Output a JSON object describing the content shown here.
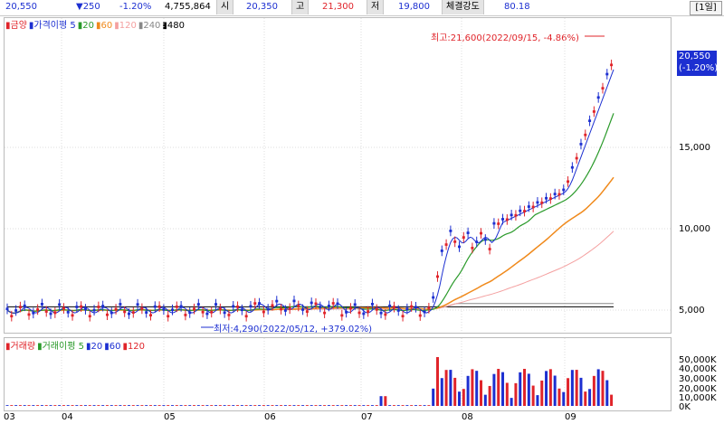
{
  "quote": {
    "price": "20,550",
    "change": "▼250",
    "change_pct": "-1.20%",
    "volume": "4,755,864",
    "open_label": "시",
    "open": "20,350",
    "high_label": "고",
    "high": "21,300",
    "low_label": "저",
    "low": "19,800",
    "strength_label": "체결강도",
    "strength": "80.18"
  },
  "period_button": "[1일]",
  "price_legend": {
    "items": [
      {
        "text": "금양",
        "color": "#e0242a"
      },
      {
        "text": "가격이평 5",
        "color": "#1c2fd1"
      },
      {
        "text": "20",
        "color": "#2a9a2a"
      },
      {
        "text": "60",
        "color": "#f08a1c"
      },
      {
        "text": "120",
        "color": "#f4a0a0"
      },
      {
        "text": "240",
        "color": "#888888"
      },
      {
        "text": "480",
        "color": "#000000"
      }
    ]
  },
  "volume_legend": {
    "items": [
      {
        "text": "거래량",
        "color": "#e0242a"
      },
      {
        "text": "거래이평 5",
        "color": "#2a9a2a"
      },
      {
        "text": "20",
        "color": "#1c2fd1"
      },
      {
        "text": "60",
        "color": "#1c2fd1"
      },
      {
        "text": "120",
        "color": "#e0242a"
      }
    ]
  },
  "annotations": {
    "high": "최고:21,600(2022/09/15, -4.86%)",
    "low": "최저:4,290(2022/05/12, +379.02%)"
  },
  "price_tag": {
    "price": "20,550",
    "pct": "(-1.20%)"
  },
  "price_axis": [
    "15,000",
    "10,000",
    "5,000"
  ],
  "volume_axis": [
    "50,000K",
    "40,000K",
    "30,000K",
    "20,000K",
    "10,000K",
    "0K"
  ],
  "x_axis": [
    "03",
    "04",
    "05",
    "06",
    "07",
    "08",
    "09"
  ],
  "colors": {
    "up": "#e0242a",
    "down": "#1c2fd1",
    "ma5": "#1c2fd1",
    "ma20": "#2a9a2a",
    "ma60": "#f08a1c",
    "ma120": "#f4a0a0",
    "ma240": "#888888",
    "ma480": "#000000"
  }
}
